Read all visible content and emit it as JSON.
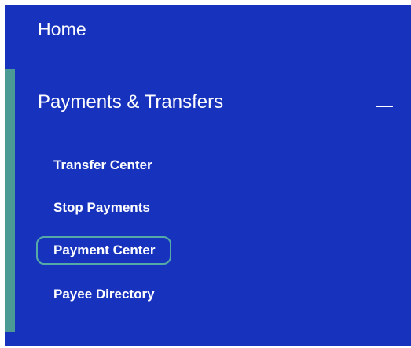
{
  "nav": {
    "home_label": "Home",
    "section": {
      "title": "Payments & Transfers",
      "toggle_icon": "collapse-minus-icon",
      "items": [
        {
          "label": "Transfer Center",
          "selected": false
        },
        {
          "label": "Stop Payments",
          "selected": false
        },
        {
          "label": "Payment Center",
          "selected": true
        },
        {
          "label": "Payee Directory",
          "selected": false
        }
      ]
    }
  },
  "colors": {
    "panel_background": "#1733bd",
    "active_rail": "#4b9a95",
    "selected_outline": "#55aaa8",
    "text": "#ffffff"
  }
}
